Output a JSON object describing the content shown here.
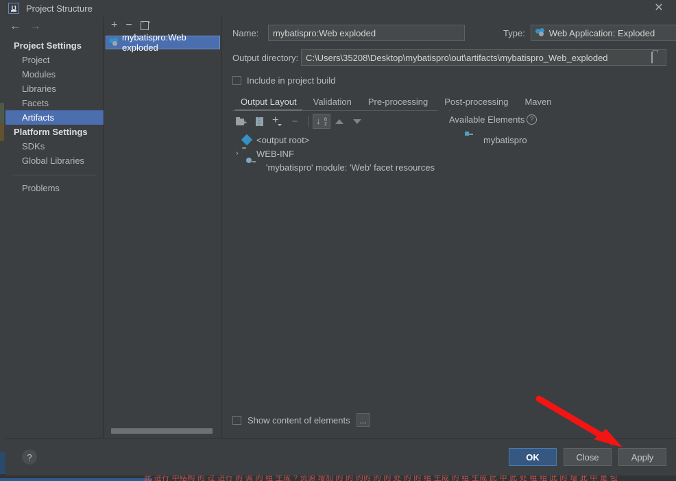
{
  "window": {
    "title": "Project Structure",
    "app_icon": "intellij-idea-logo",
    "close_label": "✕"
  },
  "nav": {
    "back_icon": "←",
    "forward_icon": "→"
  },
  "sidebar": {
    "groups": [
      {
        "label": "Project Settings",
        "items": [
          {
            "label": "Project",
            "selected": false
          },
          {
            "label": "Modules",
            "selected": false
          },
          {
            "label": "Libraries",
            "selected": false
          },
          {
            "label": "Facets",
            "selected": false
          },
          {
            "label": "Artifacts",
            "selected": true
          }
        ]
      },
      {
        "label": "Platform Settings",
        "items": [
          {
            "label": "SDKs",
            "selected": false
          },
          {
            "label": "Global Libraries",
            "selected": false
          }
        ]
      }
    ],
    "extra_items": [
      {
        "label": "Problems",
        "selected": false
      }
    ]
  },
  "artifacts_toolbar": {
    "add_label": "+",
    "remove_label": "−",
    "copy_label": "copy-icon"
  },
  "artifacts_list": {
    "items": [
      {
        "label": "mybatispro:Web exploded",
        "icon": "artifact-icon",
        "selected": true
      }
    ]
  },
  "form": {
    "name_label": "Name:",
    "name_value": "mybatispro:Web exploded",
    "type_label": "Type:",
    "type_value": "Web Application: Exploded",
    "type_icon": "artifact-icon",
    "output_dir_label": "Output directory:",
    "output_dir_value": "C:\\Users\\35208\\Desktop\\mybatispro\\out\\artifacts\\mybatispro_Web_exploded",
    "include_in_build_label": "Include in project build",
    "include_in_build_checked": false
  },
  "tabs": [
    {
      "label": "Output Layout",
      "active": true
    },
    {
      "label": "Validation",
      "active": false
    },
    {
      "label": "Pre-processing",
      "active": false
    },
    {
      "label": "Post-processing",
      "active": false
    },
    {
      "label": "Maven",
      "active": false
    }
  ],
  "layout_toolbar": {
    "buttons": [
      {
        "name": "create-directory-icon",
        "pressed": false
      },
      {
        "name": "create-archive-icon",
        "pressed": false
      },
      {
        "name": "add-copy-of-icon",
        "pressed": false
      },
      {
        "name": "remove-icon",
        "pressed": false
      },
      {
        "name": "sort-alphabetically-icon",
        "pressed": true
      },
      {
        "name": "move-up-icon",
        "pressed": false
      },
      {
        "name": "move-down-icon",
        "pressed": false
      }
    ]
  },
  "output_tree": {
    "rows": [
      {
        "label": "<output root>",
        "icon": "output-root-icon",
        "indent": 0,
        "twisty": ""
      },
      {
        "label": "WEB-INF",
        "icon": "folder-icon",
        "indent": 0,
        "twisty": "›"
      },
      {
        "label": "'mybatispro' module: 'Web' facet resources",
        "icon": "facet-resources-icon",
        "indent": 1,
        "twisty": ""
      }
    ]
  },
  "available_elements": {
    "title": "Available Elements",
    "help_icon": "?",
    "rows": [
      {
        "label": "mybatispro",
        "icon": "module-icon"
      }
    ]
  },
  "bottom_options": {
    "show_content_label": "Show content of elements",
    "show_content_checked": false,
    "ellipsis_label": "..."
  },
  "footer": {
    "help_label": "?",
    "buttons": [
      {
        "label": "OK",
        "primary": true
      },
      {
        "label": "Close",
        "primary": false
      },
      {
        "label": "Apply",
        "primary": false
      }
    ]
  },
  "annotation": {
    "arrow_color": "#f41414",
    "target": "Apply"
  },
  "background": {
    "console_text": "此 进行 中结构 的 过  进行 的 调 的 组 生成 ? 资源 增加  的 的  的的 的 的 处 的 的 组  生成 的 组 生成  此 中  此  处  组 组 此 的 增 此 中 是 包"
  }
}
